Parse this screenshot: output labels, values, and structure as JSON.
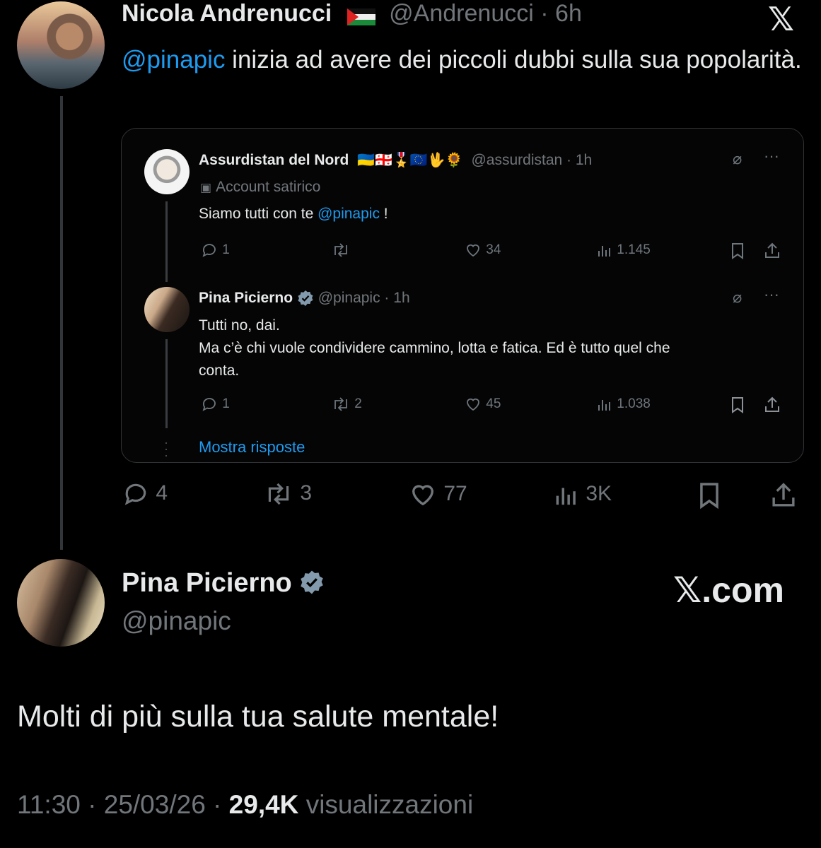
{
  "tweet": {
    "author_name": "Nicola Andrenucci",
    "handle": "@Andrenucci",
    "time": "6h",
    "mention": "@pinapic",
    "text": " inizia ad avere dei piccoli dubbi sulla sua popolarità.",
    "stats": {
      "replies": "4",
      "reposts": "3",
      "likes": "77",
      "views": "3K"
    }
  },
  "quote": {
    "post1": {
      "name": "Assurdistan del Nord",
      "emojis": "🇺🇦🇬🇪🎖️🇪🇺🖖🌻",
      "handle": "@assurdistan · 1h",
      "badge": "Account satirico",
      "text_prefix": "Siamo tutti con te ",
      "mention": "@pinapic",
      "text_suffix": " !",
      "stats": {
        "replies": "1",
        "reposts": "",
        "likes": "34",
        "views": "1.145"
      }
    },
    "post2": {
      "name": "Pina Picierno",
      "handle": "@pinapic · 1h",
      "line1": "Tutti no, dai.",
      "line2": "Ma c’è chi vuole condividere cammino, lotta e fatica. Ed è tutto quel che",
      "line3": "conta.",
      "stats": {
        "replies": "1",
        "reposts": "2",
        "likes": "45",
        "views": "1.038"
      }
    },
    "show_replies": "Mostra risposte"
  },
  "reply": {
    "name": "Pina Picierno",
    "handle": "@pinapic",
    "brand": "𝕏.com",
    "text": "Molti di più sulla tua salute mentale!",
    "time": "11:30",
    "date": "25/03/26",
    "views": "29,4K",
    "views_label": "visualizzazioni"
  },
  "colors": {
    "background": "#000000",
    "text": "#e7e9ea",
    "muted": "#71767b",
    "link": "#1d9bf0",
    "verified": "#829aab"
  }
}
